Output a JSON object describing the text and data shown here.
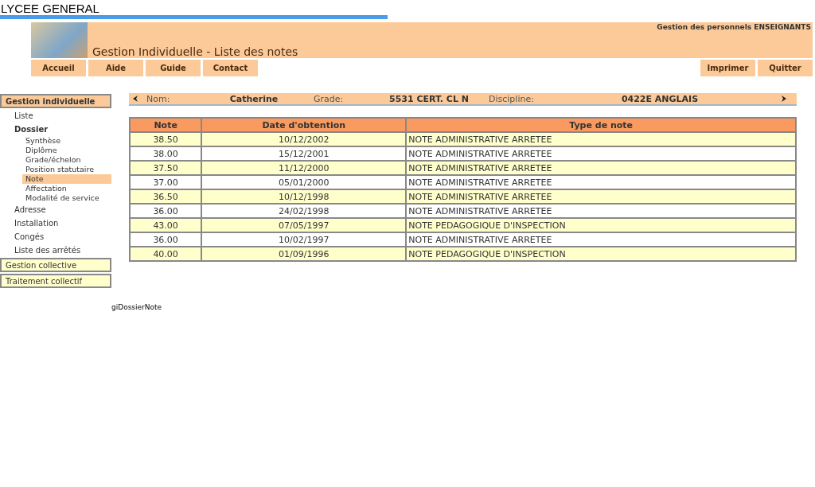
{
  "site_title": "LYCEE GENERAL",
  "header": {
    "subtitle": "Gestion des personnels ENSEIGNANTS",
    "title": "Gestion Individuelle - Liste des notes"
  },
  "nav_left": [
    "Accueil",
    "Aide",
    "Guide",
    "Contact"
  ],
  "nav_right": [
    "Imprimer",
    "Quitter"
  ],
  "sidebar": [
    {
      "label": "Gestion individuelle",
      "selected": true,
      "items": [
        {
          "label": "Liste",
          "selected": false
        },
        {
          "label": "Dossier",
          "selected": false,
          "children": [
            {
              "label": "Synthèse",
              "selected": false
            },
            {
              "label": "Diplôme",
              "selected": false
            },
            {
              "label": "Grade/échelon",
              "selected": false
            },
            {
              "label": "Position statutaire",
              "selected": false
            },
            {
              "label": "Note",
              "selected": true
            },
            {
              "label": "Affectation",
              "selected": false
            },
            {
              "label": "Modalité de service",
              "selected": false
            }
          ]
        },
        {
          "label": "Adresse",
          "selected": false
        },
        {
          "label": "Installation",
          "selected": false
        },
        {
          "label": "Congés",
          "selected": false
        },
        {
          "label": "Liste des arrêtés",
          "selected": false
        }
      ]
    },
    {
      "label": "Gestion collective",
      "selected": false
    },
    {
      "label": "Traitement collectif",
      "selected": false
    }
  ],
  "info_bar": [
    {
      "label": "Nom:",
      "value": "Catherine"
    },
    {
      "label": "Grade:",
      "value": "5531 CERT. CL N"
    },
    {
      "label": "Discipline:",
      "value": "0422E ANGLAIS"
    }
  ],
  "table": {
    "columns": [
      "Note",
      "Date d'obtention",
      "Type de note"
    ],
    "rows": [
      [
        "38.50",
        "10/12/2002",
        "NOTE ADMINISTRATIVE ARRETEE"
      ],
      [
        "38.00",
        "15/12/2001",
        "NOTE ADMINISTRATIVE ARRETEE"
      ],
      [
        "37.50",
        "11/12/2000",
        "NOTE ADMINISTRATIVE ARRETEE"
      ],
      [
        "37.00",
        "05/01/2000",
        "NOTE ADMINISTRATIVE ARRETEE"
      ],
      [
        "36.50",
        "10/12/1998",
        "NOTE ADMINISTRATIVE ARRETEE"
      ],
      [
        "36.00",
        "24/02/1998",
        "NOTE ADMINISTRATIVE ARRETEE"
      ],
      [
        "43.00",
        "07/05/1997",
        "NOTE PEDAGOGIQUE D'INSPECTION"
      ],
      [
        "36.00",
        "10/02/1997",
        "NOTE ADMINISTRATIVE ARRETEE"
      ],
      [
        "40.00",
        "01/09/1996",
        "NOTE PEDAGOGIQUE D'INSPECTION"
      ]
    ]
  },
  "page_id": "giDossierNote"
}
